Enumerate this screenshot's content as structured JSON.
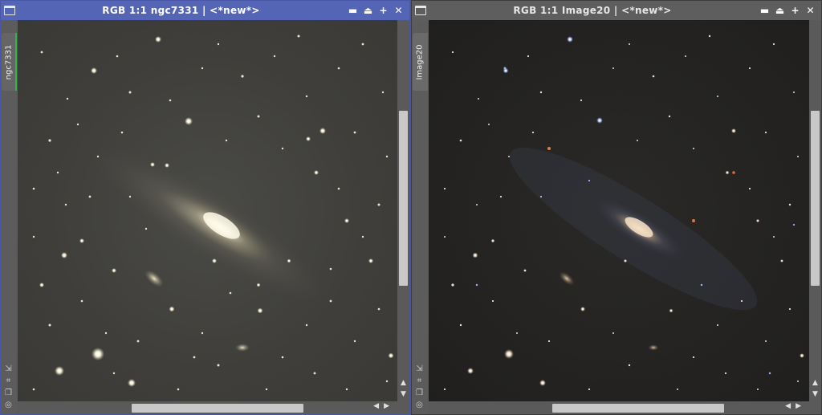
{
  "windows": {
    "left": {
      "title": "RGB 1:1 ngc7331 | <*new*>",
      "tab_label": "ngc7331",
      "image_name": "ngc7331"
    },
    "right": {
      "title": "RGB 1:1 Image20 | <*new*>",
      "tab_label": "Image20",
      "image_name": "Image20"
    }
  },
  "titlebar_buttons": {
    "shade": "▬",
    "collapse": "⏏",
    "maximize": "+",
    "close": "✕"
  },
  "sidebar_icons": [
    "⇲",
    "⌗",
    "❐",
    "◎"
  ],
  "scroll_arrows": {
    "up": "▲",
    "down": "▼",
    "left": "◀",
    "right": "▶"
  },
  "colors": {
    "active_titlebar": "#5565b5",
    "inactive_titlebar": "#5e5e5e",
    "active_tab_indicator": "#2db34f"
  }
}
